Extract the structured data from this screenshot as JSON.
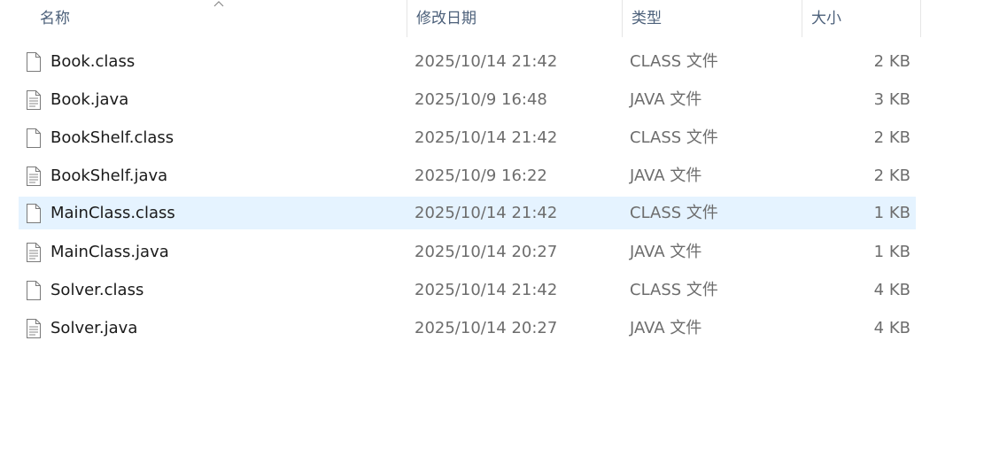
{
  "columns": {
    "name": "名称",
    "date": "修改日期",
    "type": "类型",
    "size": "大小"
  },
  "sort": {
    "column": "name",
    "direction": "ascending",
    "icon": "sort-up-icon"
  },
  "selected_index": 4,
  "files": [
    {
      "name": "Book.class",
      "date": "2025/10/14 21:42",
      "type": "CLASS 文件",
      "size": "2 KB",
      "icon": "blank-file-icon"
    },
    {
      "name": "Book.java",
      "date": "2025/10/9 16:48",
      "type": "JAVA 文件",
      "size": "3 KB",
      "icon": "text-file-icon"
    },
    {
      "name": "BookShelf.class",
      "date": "2025/10/14 21:42",
      "type": "CLASS 文件",
      "size": "2 KB",
      "icon": "blank-file-icon"
    },
    {
      "name": "BookShelf.java",
      "date": "2025/10/9 16:22",
      "type": "JAVA 文件",
      "size": "2 KB",
      "icon": "text-file-icon"
    },
    {
      "name": "MainClass.class",
      "date": "2025/10/14 21:42",
      "type": "CLASS 文件",
      "size": "1 KB",
      "icon": "blank-file-icon"
    },
    {
      "name": "MainClass.java",
      "date": "2025/10/14 20:27",
      "type": "JAVA 文件",
      "size": "1 KB",
      "icon": "text-file-icon"
    },
    {
      "name": "Solver.class",
      "date": "2025/10/14 21:42",
      "type": "CLASS 文件",
      "size": "4 KB",
      "icon": "blank-file-icon"
    },
    {
      "name": "Solver.java",
      "date": "2025/10/14 20:27",
      "type": "JAVA 文件",
      "size": "4 KB",
      "icon": "text-file-icon"
    }
  ]
}
